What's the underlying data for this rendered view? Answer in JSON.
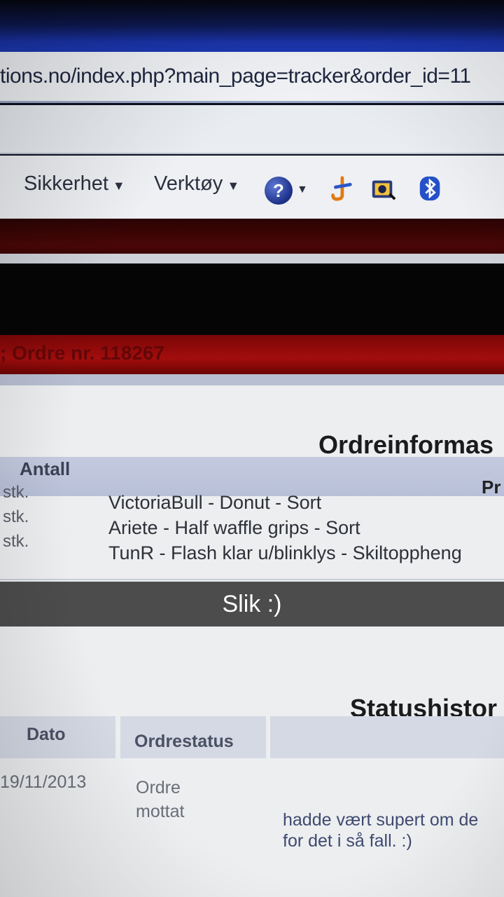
{
  "browser": {
    "url": "tions.no/index.php?main_page=tracker&order_id=11",
    "menus": [
      {
        "label": "Sikkerhet"
      },
      {
        "label": "Verktøy"
      }
    ],
    "help_icon_glyph": "?",
    "icons": [
      "help-icon",
      "paint-icon",
      "camera-icon",
      "bluetooth-icon"
    ]
  },
  "header": {
    "order_number_text": "; Ordre nr. 118267"
  },
  "order_info": {
    "title": "Ordreinformas",
    "columns": [
      "Antall",
      "Pr"
    ],
    "rows": [
      {
        "qty": "stk.",
        "product": "VictoriaBull - Donut - Sort"
      },
      {
        "qty": "stk.",
        "product": "Ariete - Half waffle grips - Sort"
      },
      {
        "qty": "stk.",
        "product": "TunR - Flash klar u/blinklys - Skiltoppheng"
      }
    ]
  },
  "caption": "Slik :)",
  "status_history": {
    "title": "Statushistor",
    "columns": [
      "Dato",
      "Ordrestatus"
    ],
    "entry": {
      "date": "19/11/2013",
      "status_line1": "Ordre",
      "status_line2": "mottat",
      "comment_line1": "hadde vært supert om de",
      "comment_line2": "for det i så fall. :)"
    }
  },
  "colors": {
    "browser_blue": "#1d3bb8",
    "dark_red": "#4a0606",
    "order_red": "#a30d0d",
    "table_header": "#c4cbe0"
  }
}
